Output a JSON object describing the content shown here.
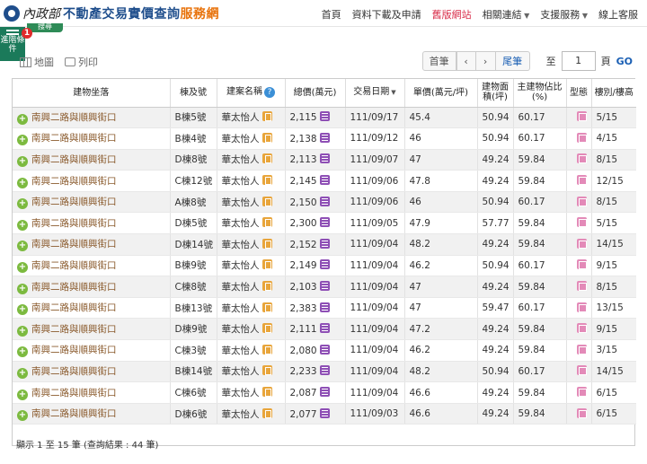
{
  "header": {
    "ministry": "內政部",
    "title_main": "不動產交易實價查詢",
    "title_accent": "服務網"
  },
  "nav": {
    "items": [
      {
        "label": "首頁",
        "dropdown": false,
        "style": "normal"
      },
      {
        "label": "資料下載及申請",
        "dropdown": false,
        "style": "normal"
      },
      {
        "label": "舊版網站",
        "dropdown": false,
        "style": "old"
      },
      {
        "label": "相關連結",
        "dropdown": true,
        "style": "normal"
      },
      {
        "label": "支援服務",
        "dropdown": true,
        "style": "normal"
      },
      {
        "label": "線上客服",
        "dropdown": false,
        "style": "normal"
      }
    ]
  },
  "sidebar": {
    "label": "進階條件",
    "badge": "1",
    "green_tab": "搜尋"
  },
  "toolbar": {
    "map_label": "地圖",
    "print_label": "列印"
  },
  "pager": {
    "first": "首筆",
    "prev": "‹",
    "next": "›",
    "last": "尾筆",
    "to_label": "至",
    "page_value": "1",
    "page_unit": "頁",
    "go_label": "GO"
  },
  "table": {
    "headers": {
      "address": "建物坐落",
      "building_no": "棟及號",
      "community": "建案名稱",
      "total_price": "總價(萬元)",
      "trade_date": "交易日期",
      "unit_price": "單價(萬元/坪)",
      "area": "建物面積(坪)",
      "main_ratio": "主建物佔比(%)",
      "type": "型態",
      "floor": "樓別/樓高"
    },
    "rows": [
      {
        "address": "南興二路與順興街口",
        "building": "B棟5號",
        "community": "華太怡人",
        "total": "2,115",
        "date": "111/09/17",
        "unit": "45.4",
        "area": "50.94",
        "ratio": "60.17",
        "floor": "5/15"
      },
      {
        "address": "南興二路與順興街口",
        "building": "B棟4號",
        "community": "華太怡人",
        "total": "2,138",
        "date": "111/09/12",
        "unit": "46",
        "area": "50.94",
        "ratio": "60.17",
        "floor": "4/15"
      },
      {
        "address": "南興二路與順興街口",
        "building": "D棟8號",
        "community": "華太怡人",
        "total": "2,113",
        "date": "111/09/07",
        "unit": "47",
        "area": "49.24",
        "ratio": "59.84",
        "floor": "8/15"
      },
      {
        "address": "南興二路與順興街口",
        "building": "C棟12號",
        "community": "華太怡人",
        "total": "2,145",
        "date": "111/09/06",
        "unit": "47.8",
        "area": "49.24",
        "ratio": "59.84",
        "floor": "12/15"
      },
      {
        "address": "南興二路與順興街口",
        "building": "A棟8號",
        "community": "華太怡人",
        "total": "2,150",
        "date": "111/09/06",
        "unit": "46",
        "area": "50.94",
        "ratio": "60.17",
        "floor": "8/15"
      },
      {
        "address": "南興二路與順興街口",
        "building": "D棟5號",
        "community": "華太怡人",
        "total": "2,300",
        "date": "111/09/05",
        "unit": "47.9",
        "area": "57.77",
        "ratio": "59.84",
        "floor": "5/15"
      },
      {
        "address": "南興二路與順興街口",
        "building": "D棟14號",
        "community": "華太怡人",
        "total": "2,152",
        "date": "111/09/04",
        "unit": "48.2",
        "area": "49.24",
        "ratio": "59.84",
        "floor": "14/15"
      },
      {
        "address": "南興二路與順興街口",
        "building": "B棟9號",
        "community": "華太怡人",
        "total": "2,149",
        "date": "111/09/04",
        "unit": "46.2",
        "area": "50.94",
        "ratio": "60.17",
        "floor": "9/15"
      },
      {
        "address": "南興二路與順興街口",
        "building": "C棟8號",
        "community": "華太怡人",
        "total": "2,103",
        "date": "111/09/04",
        "unit": "47",
        "area": "49.24",
        "ratio": "59.84",
        "floor": "8/15"
      },
      {
        "address": "南興二路與順興街口",
        "building": "B棟13號",
        "community": "華太怡人",
        "total": "2,383",
        "date": "111/09/04",
        "unit": "47",
        "area": "59.47",
        "ratio": "60.17",
        "floor": "13/15"
      },
      {
        "address": "南興二路與順興街口",
        "building": "D棟9號",
        "community": "華太怡人",
        "total": "2,111",
        "date": "111/09/04",
        "unit": "47.2",
        "area": "49.24",
        "ratio": "59.84",
        "floor": "9/15"
      },
      {
        "address": "南興二路與順興街口",
        "building": "C棟3號",
        "community": "華太怡人",
        "total": "2,080",
        "date": "111/09/04",
        "unit": "46.2",
        "area": "49.24",
        "ratio": "59.84",
        "floor": "3/15"
      },
      {
        "address": "南興二路與順興街口",
        "building": "B棟14號",
        "community": "華太怡人",
        "total": "2,233",
        "date": "111/09/04",
        "unit": "48.2",
        "area": "50.94",
        "ratio": "60.17",
        "floor": "14/15"
      },
      {
        "address": "南興二路與順興街口",
        "building": "C棟6號",
        "community": "華太怡人",
        "total": "2,087",
        "date": "111/09/04",
        "unit": "46.6",
        "area": "49.24",
        "ratio": "59.84",
        "floor": "6/15"
      },
      {
        "address": "南興二路與順興街口",
        "building": "D棟6號",
        "community": "華太怡人",
        "total": "2,077",
        "date": "111/09/03",
        "unit": "46.6",
        "area": "49.24",
        "ratio": "59.84",
        "floor": "6/15"
      }
    ]
  },
  "footer": {
    "summary": "顯示 1 至 15 筆 (查詢結果 : 44 筆)"
  },
  "colors": {
    "brand_blue": "#1f4e8c",
    "brand_orange": "#e8730c",
    "link_blue": "#1a5fb4",
    "expand_green": "#7cba3f",
    "calc_purple": "#8e4fb5",
    "type_pink": "#e38ab8"
  }
}
